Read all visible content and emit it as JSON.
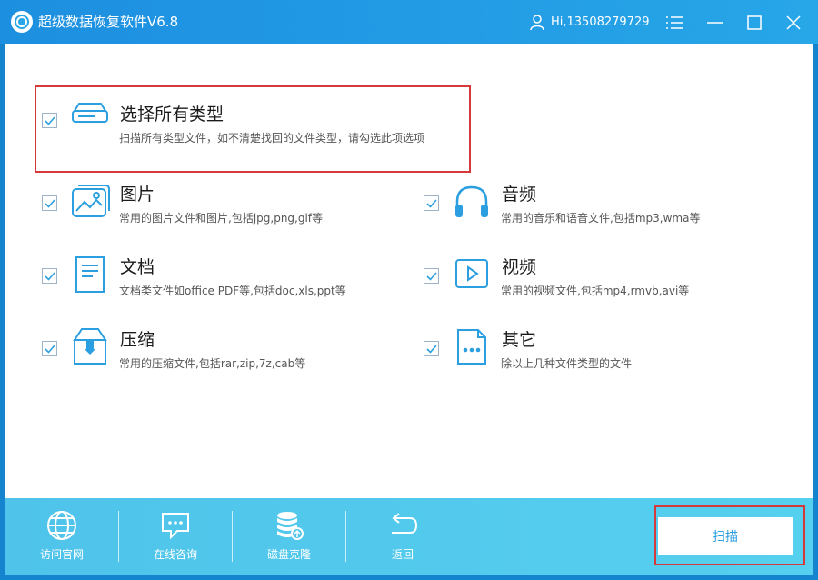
{
  "window": {
    "title": "超级数据恢复软件V6.8",
    "user": "Hi,13508279729"
  },
  "categories": {
    "all": {
      "title": "选择所有类型",
      "desc": "扫描所有类型文件，如不清楚找回的文件类型，请勾选此项选项",
      "checked": true
    },
    "image": {
      "title": "图片",
      "desc": "常用的图片文件和图片,包括jpg,png,gif等",
      "checked": true
    },
    "audio": {
      "title": "音频",
      "desc": "常用的音乐和语音文件,包括mp3,wma等",
      "checked": true
    },
    "document": {
      "title": "文档",
      "desc": "文档类文件如office PDF等,包括doc,xls,ppt等",
      "checked": true
    },
    "video": {
      "title": "视频",
      "desc": "常用的视频文件,包括mp4,rmvb,avi等",
      "checked": true
    },
    "archive": {
      "title": "压缩",
      "desc": "常用的压缩文件,包括rar,zip,7z,cab等",
      "checked": true
    },
    "other": {
      "title": "其它",
      "desc": "除以上几种文件类型的文件",
      "checked": true
    }
  },
  "bottom": {
    "nav": [
      {
        "label": "访问官网",
        "icon": "globe-icon"
      },
      {
        "label": "在线咨询",
        "icon": "chat-icon"
      },
      {
        "label": "磁盘克隆",
        "icon": "disk-clone-icon"
      },
      {
        "label": "返回",
        "icon": "back-icon"
      }
    ],
    "scan_label": "扫描"
  },
  "colors": {
    "title_bar": "#1d8fe0",
    "accent": "#2c9fe0",
    "bottom_bar": "#4fc3ea",
    "highlight": "#d6393a"
  }
}
